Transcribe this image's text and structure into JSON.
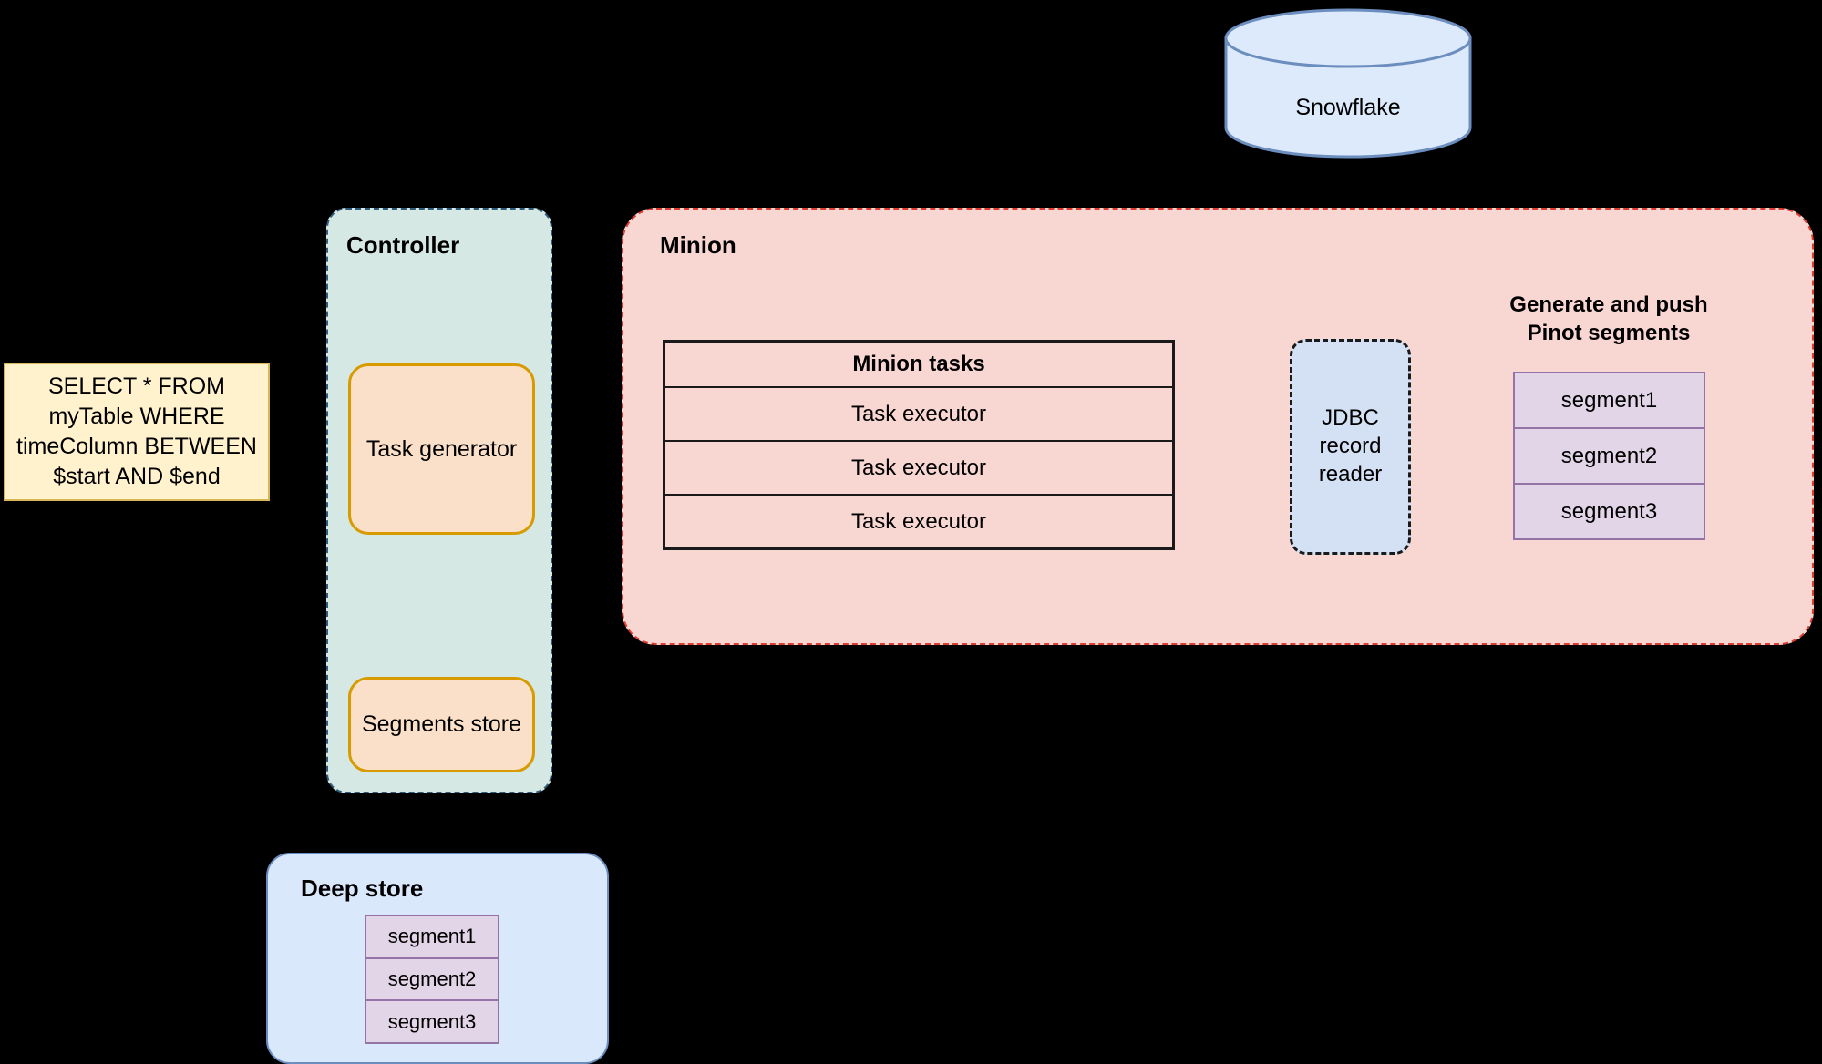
{
  "sql": {
    "text": "SELECT * FROM myTable WHERE timeColumn BETWEEN $start AND $end"
  },
  "controller": {
    "title": "Controller",
    "task_generator": "Task generator",
    "segments_store": "Segments store"
  },
  "minion": {
    "title": "Minion",
    "tasks_table": {
      "header": "Minion tasks",
      "rows": [
        "Task executor",
        "Task executor",
        "Task executor"
      ]
    },
    "jdbc_reader": "JDBC record reader",
    "generate_label": "Generate and push Pinot segments",
    "segments": [
      "segment1",
      "segment2",
      "segment3"
    ]
  },
  "snowflake": {
    "label": "Snowflake"
  },
  "deep_store": {
    "title": "Deep store",
    "segments": [
      "segment1",
      "segment2",
      "segment3"
    ]
  },
  "colors": {
    "background": "#000000",
    "sql_fill": "#FFF2CC",
    "sql_stroke": "#D6B656",
    "controller_fill": "#D5E8E4",
    "controller_stroke": "#2F5B7C",
    "task_fill": "#FAE0C8",
    "task_stroke": "#D79B00",
    "minion_fill": "#F8D7D3",
    "minion_stroke": "#E03C31",
    "jdbc_fill": "#D4E1F5",
    "jdbc_stroke": "#1A1A1A",
    "segment_fill": "#E1D5E7",
    "segment_stroke": "#9673A6",
    "deep_store_fill": "#DAE8FC",
    "deep_store_stroke": "#6C8EBF",
    "snowflake_fill": "#DDEAFB",
    "snowflake_stroke": "#6C8EBF",
    "edge_stroke": "#000000"
  }
}
